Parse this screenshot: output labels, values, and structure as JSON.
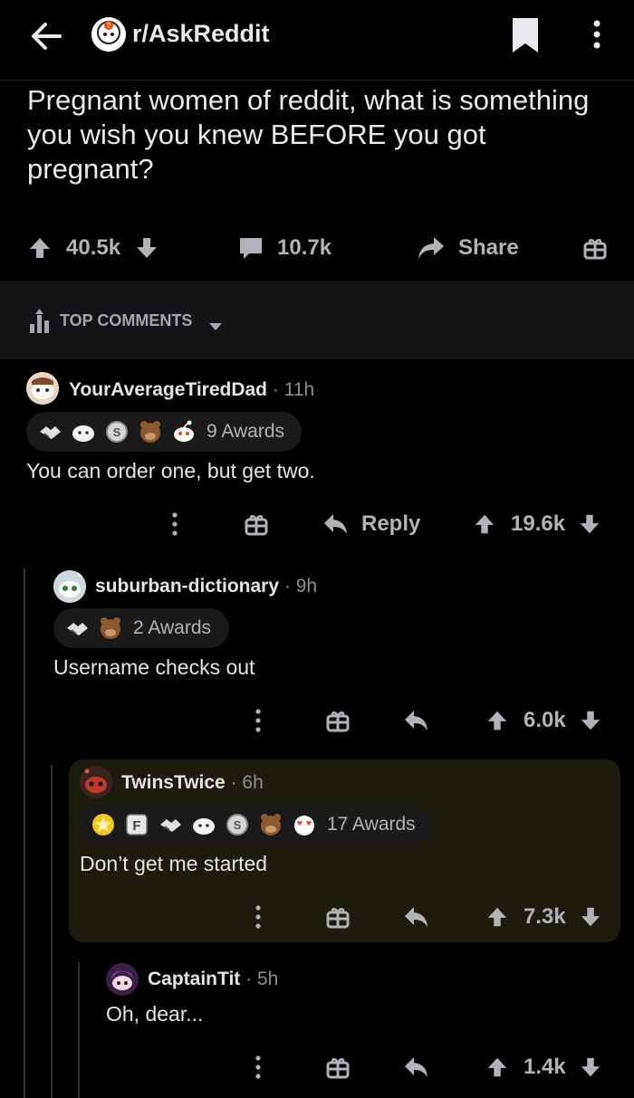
{
  "header": {
    "subreddit": "r/AskReddit"
  },
  "post": {
    "title": "Pregnant women of reddit, what is something you wish you knew BEFORE you got pregnant?",
    "score": "40.5k",
    "comments": "10.7k",
    "share_label": "Share"
  },
  "sort": {
    "label": "TOP COMMENTS"
  },
  "comments": [
    {
      "user": "YourAverageTiredDad",
      "meta": "· 11h",
      "awards_label": "9 Awards",
      "body": "You can order one, but get two.",
      "reply_label": "Reply",
      "score": "19.6k"
    },
    {
      "user": "suburban-dictionary",
      "meta": "· 9h",
      "awards_label": "2 Awards",
      "body": "Username checks out",
      "score": "6.0k"
    },
    {
      "user": "TwinsTwice",
      "meta": "· 6h",
      "awards_label": "17 Awards",
      "body": "Don’t get me started",
      "score": "7.3k"
    },
    {
      "user": "CaptainTit",
      "meta": "· 5h",
      "body": "Oh, dear...",
      "score": "1.4k"
    }
  ],
  "colors": {
    "background": "#000000",
    "highlight": "#1d1a0e",
    "text_muted": "#b0b3b8"
  }
}
